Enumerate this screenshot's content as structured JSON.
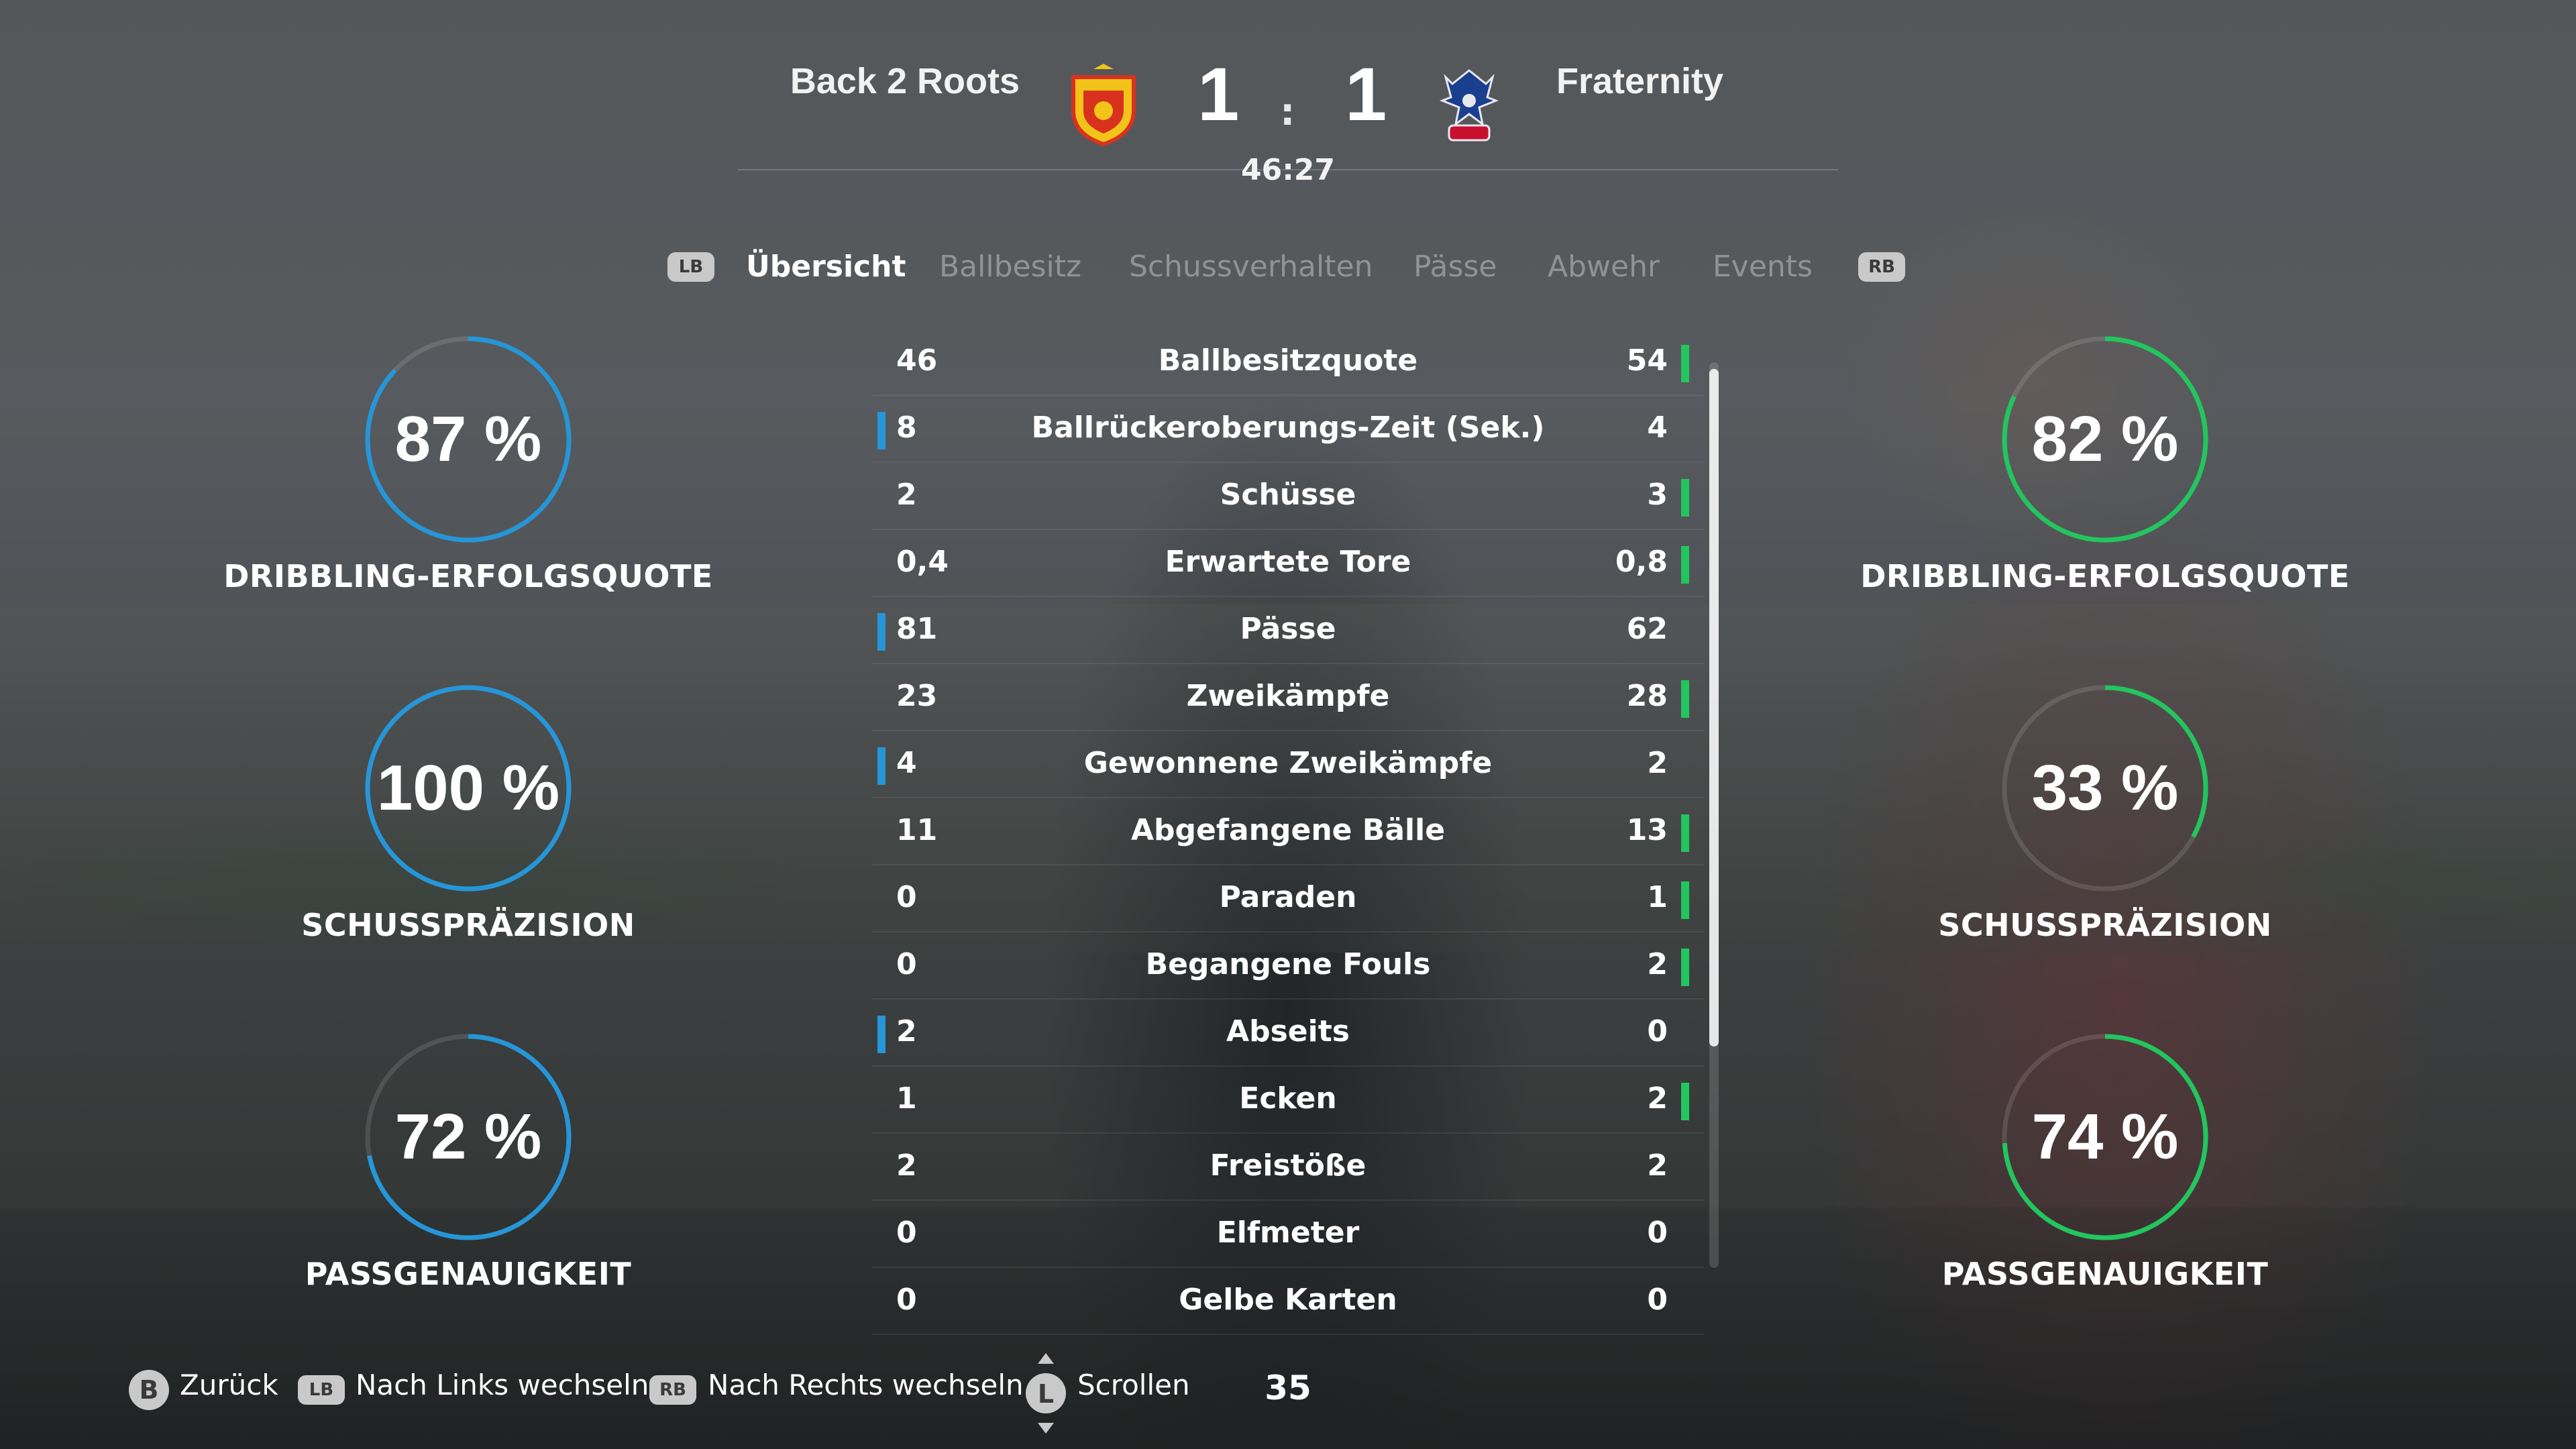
{
  "match": {
    "home_team": "Back 2 Roots",
    "away_team": "Fraternity",
    "home_score": "1",
    "away_score": "1",
    "separator": ":",
    "clock": "46:27",
    "home_color": "#2596d8",
    "away_color": "#22c55e"
  },
  "tabs": {
    "lb": "LB",
    "rb": "RB",
    "items": [
      "Übersicht",
      "Ballbesitz",
      "Schussverhalten",
      "Pässe",
      "Abwehr",
      "Events"
    ],
    "active": "Übersicht"
  },
  "home_gauges": [
    {
      "value": "87 %",
      "percent": 87,
      "label": "DRIBBLING-ERFOLGSQUOTE"
    },
    {
      "value": "100 %",
      "percent": 100,
      "label": "SCHUSSPRÄZISION"
    },
    {
      "value": "72 %",
      "percent": 72,
      "label": "PASSGENAUIGKEIT"
    }
  ],
  "away_gauges": [
    {
      "value": "82 %",
      "percent": 82,
      "label": "DRIBBLING-ERFOLGSQUOTE"
    },
    {
      "value": "33 %",
      "percent": 33,
      "label": "SCHUSSPRÄZISION"
    },
    {
      "value": "74 %",
      "percent": 74,
      "label": "PASSGENAUIGKEIT"
    }
  ],
  "stats": [
    {
      "label": "Ballbesitzquote",
      "home": "46",
      "away": "54",
      "leader": "away"
    },
    {
      "label": "Ballrückeroberungs-Zeit (Sek.)",
      "home": "8",
      "away": "4",
      "leader": "home"
    },
    {
      "label": "Schüsse",
      "home": "2",
      "away": "3",
      "leader": "away"
    },
    {
      "label": "Erwartete Tore",
      "home": "0,4",
      "away": "0,8",
      "leader": "away"
    },
    {
      "label": "Pässe",
      "home": "81",
      "away": "62",
      "leader": "home"
    },
    {
      "label": "Zweikämpfe",
      "home": "23",
      "away": "28",
      "leader": "away"
    },
    {
      "label": "Gewonnene Zweikämpfe",
      "home": "4",
      "away": "2",
      "leader": "home"
    },
    {
      "label": "Abgefangene Bälle",
      "home": "11",
      "away": "13",
      "leader": "away"
    },
    {
      "label": "Paraden",
      "home": "0",
      "away": "1",
      "leader": "away"
    },
    {
      "label": "Begangene Fouls",
      "home": "0",
      "away": "2",
      "leader": "away"
    },
    {
      "label": "Abseits",
      "home": "2",
      "away": "0",
      "leader": "home"
    },
    {
      "label": "Ecken",
      "home": "1",
      "away": "2",
      "leader": "away"
    },
    {
      "label": "Freistöße",
      "home": "2",
      "away": "2",
      "leader": "none"
    },
    {
      "label": "Elfmeter",
      "home": "0",
      "away": "0",
      "leader": "none"
    },
    {
      "label": "Gelbe Karten",
      "home": "0",
      "away": "0",
      "leader": "none"
    }
  ],
  "footer": {
    "back_btn": "B",
    "back_label": "Zurück",
    "lb_btn": "LB",
    "left_label": "Nach Links wechseln",
    "rb_btn": "RB",
    "right_label": "Nach Rechts wechseln",
    "l_btn": "L",
    "scroll_label": "Scrollen",
    "page_number": "35"
  }
}
